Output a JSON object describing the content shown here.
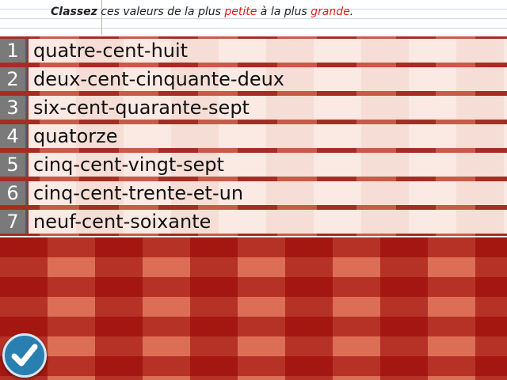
{
  "instruction": {
    "part1": "Classez",
    "part2": " ces valeurs de la plus ",
    "part3": "petite",
    "part4": " à la plus ",
    "part5": "grande",
    "part6": "."
  },
  "items": [
    {
      "number": "1",
      "label": "quatre-cent-huit"
    },
    {
      "number": "2",
      "label": "deux-cent-cinquante-deux"
    },
    {
      "number": "3",
      "label": "six-cent-quarante-sept"
    },
    {
      "number": "4",
      "label": "quatorze"
    },
    {
      "number": "5",
      "label": "cinq-cent-vingt-sept"
    },
    {
      "number": "6",
      "label": "cinq-cent-trente-et-un"
    },
    {
      "number": "7",
      "label": "neuf-cent-soixante"
    }
  ],
  "check_button": {
    "icon": "checkmark-icon"
  },
  "colors": {
    "accent_red": "#e02020",
    "number_badge": "#7a7a7a",
    "row_background": "#fbe9e3",
    "check_button": "#2a7fb1"
  }
}
